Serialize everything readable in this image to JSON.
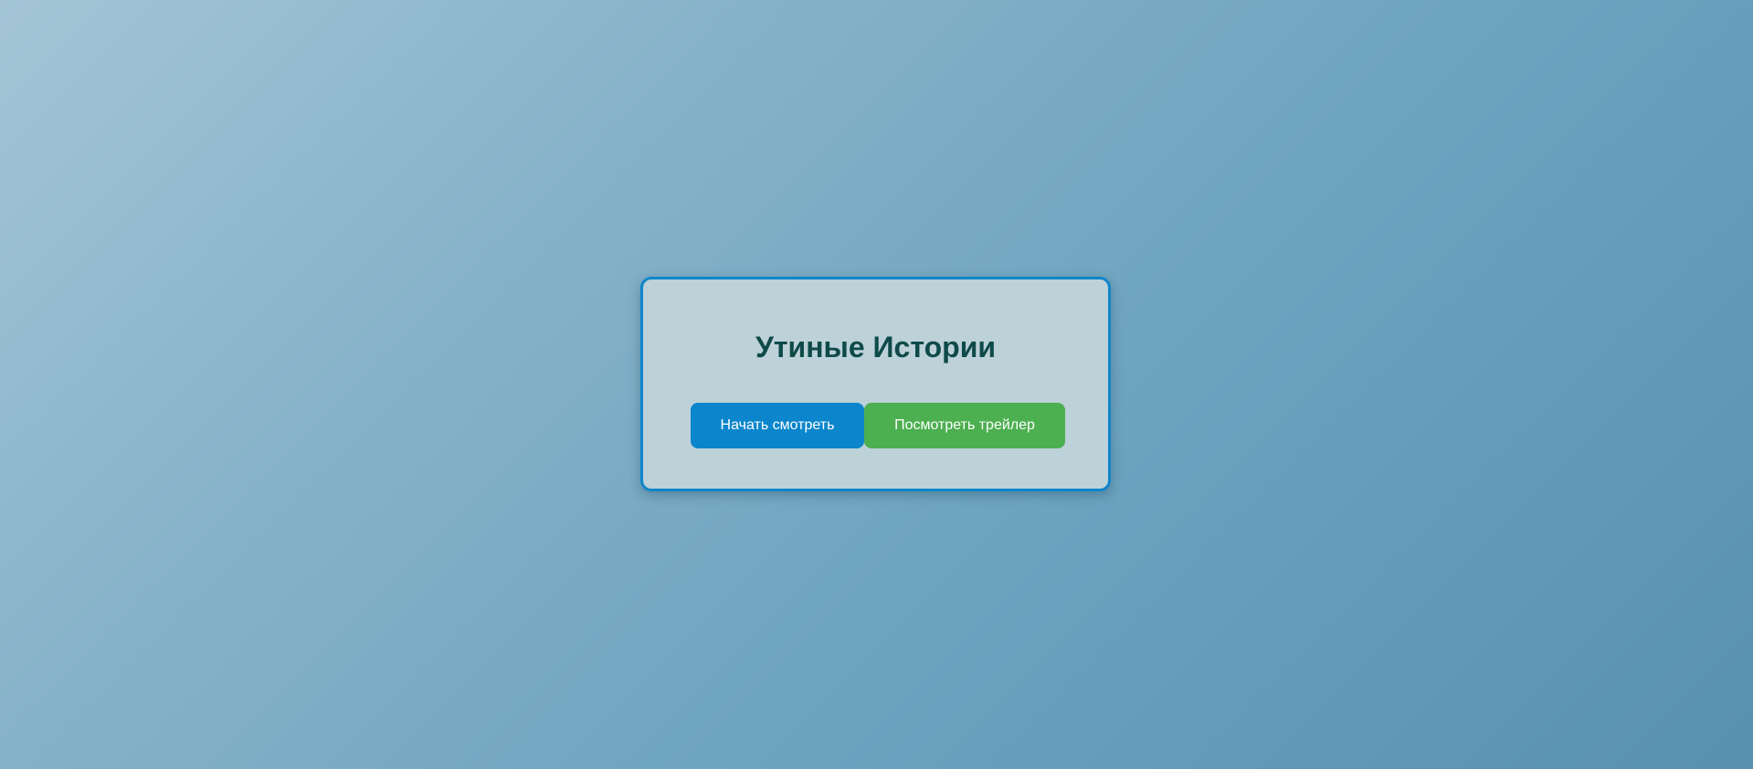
{
  "colors": {
    "card_border": "#0f86c9",
    "title": "#0f4a4a",
    "start_button": "#0b86cc",
    "trailer_button": "#4caf50"
  },
  "card": {
    "title": "Утиные Истории",
    "start_button_label": "Начать смотреть",
    "trailer_button_label": "Посмотреть трейлер"
  }
}
